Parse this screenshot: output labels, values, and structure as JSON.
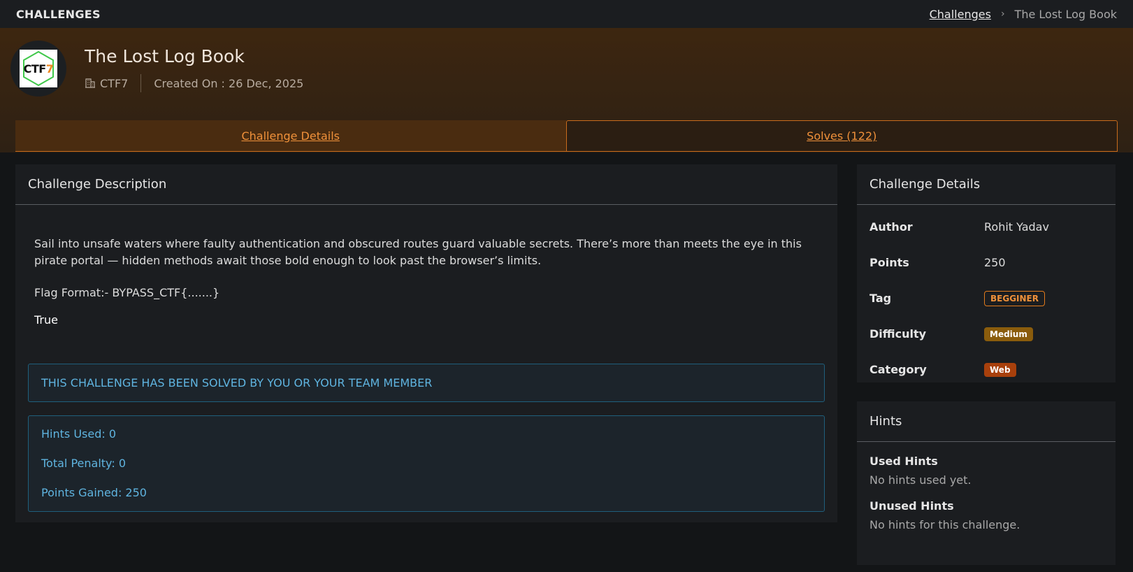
{
  "header": {
    "brand": "CHALLENGES",
    "breadcrumb": {
      "link": "Challenges",
      "current": "The Lost Log Book"
    }
  },
  "challenge": {
    "title": "The Lost Log Book",
    "org": "CTF7",
    "created": "Created On : 26 Dec, 2025",
    "logo_text": "CTF",
    "logo_digit": "7"
  },
  "tabs": [
    {
      "label": "Challenge Details",
      "active": true
    },
    {
      "label": "Solves (122)",
      "active": false
    }
  ],
  "description": {
    "heading": "Challenge Description",
    "text": "Sail into unsafe waters where faulty authentication and obscured routes guard valuable secrets. There’s more than meets the eye in this pirate portal — hidden methods await those bold enough to look past the browser’s limits.",
    "flag_format": "Flag Format:- BYPASS_CTF{.......}",
    "extra": "True",
    "solved_notice": "THIS CHALLENGE HAS BEEN SOLVED BY YOU OR YOUR TEAM MEMBER",
    "stats": {
      "hints_used": "Hints Used: 0",
      "total_penalty": "Total Penalty: 0",
      "points_gained": "Points Gained: 250"
    }
  },
  "details": {
    "heading": "Challenge Details",
    "rows": [
      {
        "key": "Author",
        "value": "Rohit Yadav"
      },
      {
        "key": "Points",
        "value": "250"
      },
      {
        "key": "Tag",
        "value": "BEGGINER"
      },
      {
        "key": "Difficulty",
        "value": "Medium"
      },
      {
        "key": "Category",
        "value": "Web"
      }
    ]
  },
  "hints": {
    "heading": "Hints",
    "used_title": "Used Hints",
    "used_text": "No hints used yet.",
    "unused_title": "Unused Hints",
    "unused_text": "No hints for this challenge."
  },
  "colors": {
    "accent": "#f0913a",
    "info": "#5fb4e0",
    "badge_medium": "#8a5c0c",
    "badge_web": "#a8400c"
  }
}
